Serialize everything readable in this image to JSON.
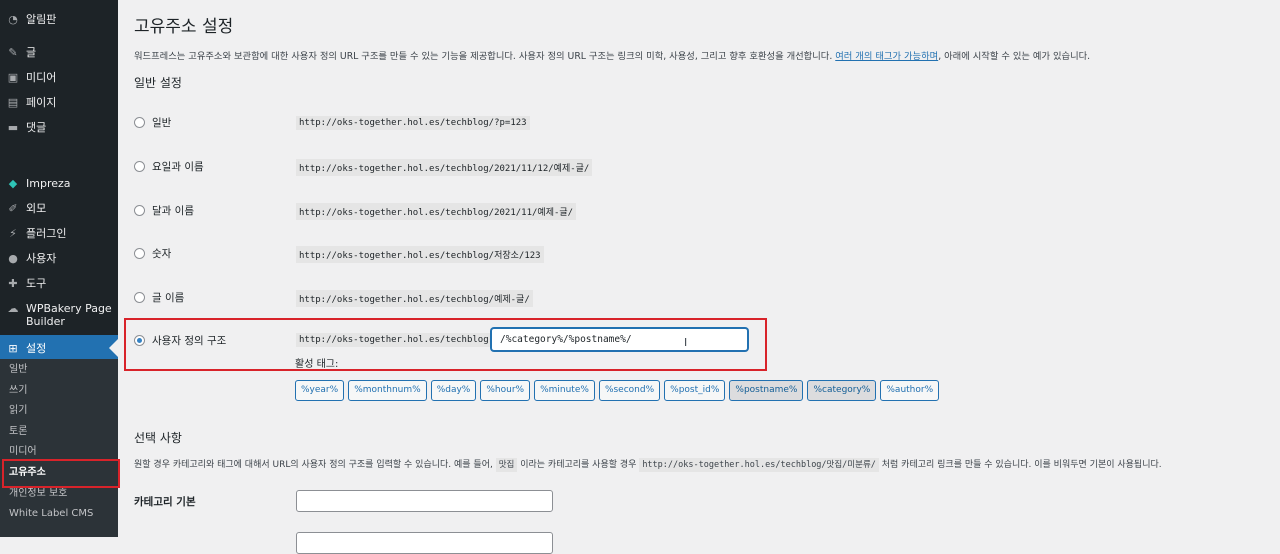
{
  "sidebar": {
    "items": [
      {
        "label": "알림판",
        "icon": "dashboard-icon"
      },
      {
        "label": "글",
        "icon": "pin-icon"
      },
      {
        "label": "미디어",
        "icon": "media-icon"
      },
      {
        "label": "페이지",
        "icon": "page-icon"
      },
      {
        "label": "댓글",
        "icon": "comment-icon"
      },
      {
        "label": "Impreza",
        "icon": "diamond-icon"
      },
      {
        "label": "외모",
        "icon": "brush-icon"
      },
      {
        "label": "플러그인",
        "icon": "plugin-icon"
      },
      {
        "label": "사용자",
        "icon": "user-icon"
      },
      {
        "label": "도구",
        "icon": "wrench-icon"
      },
      {
        "label": "WPBakery Page Builder",
        "icon": "cloud-icon"
      },
      {
        "label": "설정",
        "icon": "settings-icon"
      }
    ],
    "submenu": [
      "일반",
      "쓰기",
      "읽기",
      "토론",
      "미디어",
      "고유주소",
      "개인정보 보호",
      "White Label CMS"
    ]
  },
  "page": {
    "title": "고유주소 설정",
    "description_pre": "워드프레스는 고유주소와 보관함에 대한 사용자 정의 URL 구조를 만들 수 있는 기능을 제공합니다. 사용자 정의 URL 구조는 링크의 미학, 사용성, 그리고 향후 호환성을 개선합니다. ",
    "description_link": "여러 개의 태그가 가능하며",
    "description_post": ", 아래에 시작할 수 있는 예가 있습니다.",
    "general_heading": "일반 설정",
    "options": [
      {
        "label": "일반",
        "example": "http://oks-together.hol.es/techblog/?p=123"
      },
      {
        "label": "요일과 이름",
        "example": "http://oks-together.hol.es/techblog/2021/11/12/예제-글/"
      },
      {
        "label": "달과 이름",
        "example": "http://oks-together.hol.es/techblog/2021/11/예제-글/"
      },
      {
        "label": "숫자",
        "example": "http://oks-together.hol.es/techblog/저장소/123"
      },
      {
        "label": "글 이름",
        "example": "http://oks-together.hol.es/techblog/예제-글/"
      }
    ],
    "custom": {
      "label": "사용자 정의 구조",
      "base": "http://oks-together.hol.es/techblog",
      "value": "/%category%/%postname%/",
      "available_tags_label": "활성 태그:",
      "tags": [
        "%year%",
        "%monthnum%",
        "%day%",
        "%hour%",
        "%minute%",
        "%second%",
        "%post_id%",
        "%postname%",
        "%category%",
        "%author%"
      ]
    },
    "optional_heading": "선택 사항",
    "optional_desc_pre": "원할 경우 카테고리와 태그에 대해서 URL의 사용자 정의 구조를 입력할 수 있습니다. 예를 들어, ",
    "optional_code1": "맛집",
    "optional_desc_mid": " 이라는 카테고리를 사용할 경우 ",
    "optional_code2": "http://oks-together.hol.es/techblog/맛집/미분류/",
    "optional_desc_post": " 처럼 카테고리 링크를 만들 수 있습니다. 이를 비워두면 기본이 사용됩니다.",
    "category_base_label": "카테고리 기본"
  }
}
